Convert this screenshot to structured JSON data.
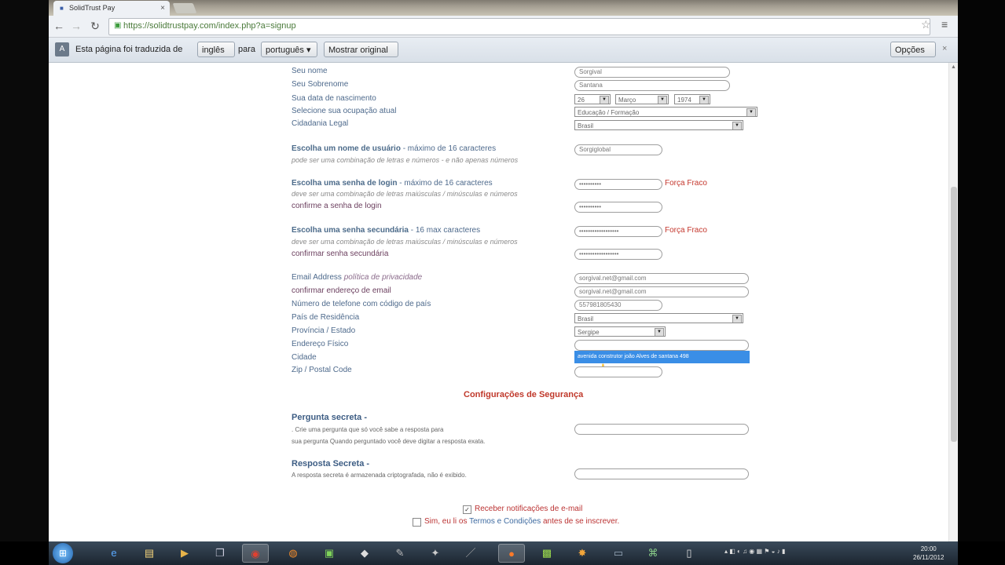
{
  "browser": {
    "tab_title": "SolidTrust Pay",
    "tab_close": "×",
    "url": "https://solidtrustpay.com/index.php?a=signup"
  },
  "translate_bar": {
    "text_before": "Esta página foi traduzida de",
    "from_lang": "inglês",
    "text_middle": "para",
    "to_lang": "português",
    "show_original": "Mostrar original",
    "options": "Opções",
    "close": "×"
  },
  "form": {
    "first_name": {
      "label": "Seu nome",
      "value": "Sorgival"
    },
    "last_name": {
      "label": "Seu Sobrenome",
      "value": "Santana"
    },
    "dob": {
      "label": "Sua data de nascimento",
      "day": "26",
      "month": "Março",
      "year": "1974"
    },
    "occupation": {
      "label": "Selecione sua ocupação atual",
      "value": "Educação / Formação"
    },
    "citizenship": {
      "label": "Cidadania Legal",
      "value": "Brasil"
    },
    "username": {
      "label_bold": "Escolha um nome de usuário",
      "label_rest": " - máximo de 16 caracteres",
      "hint": "pode ser uma combinação de letras e números - e não apenas números",
      "value": "Sorgiglobal"
    },
    "login_password": {
      "label_bold": "Escolha uma senha de login",
      "label_rest": " - máximo de 16 caracteres",
      "hint": "deve ser uma combinação de letras maiúsculas / minúsculas e números",
      "value": "••••••••••",
      "strength": "Força Fraco"
    },
    "confirm_login_password": {
      "label": "confirme a senha de login",
      "value": "••••••••••"
    },
    "secondary_password": {
      "label_bold": "Escolha uma senha secundária",
      "label_rest": " - 16 max caracteres",
      "hint": "deve ser uma combinação de letras maiúsculas / minúsculas e números",
      "value": "••••••••••••••••••",
      "strength": "Força Fraco"
    },
    "confirm_secondary_password": {
      "label": "confirmar senha secundária",
      "value": "••••••••••••••••••"
    },
    "email": {
      "label": "Email Address",
      "privacy": "política de privacidade",
      "value": "sorgival.net@gmail.com"
    },
    "confirm_email": {
      "label": "confirmar endereço de email",
      "value": "sorgival.net@gmail.com"
    },
    "phone": {
      "label": "Número de telefone com código de país",
      "value": "557981805430"
    },
    "country": {
      "label": "País de Residência",
      "value": "Brasil"
    },
    "province": {
      "label": "Província / Estado",
      "value": "Sergipe"
    },
    "address": {
      "label": "Endereço Físico",
      "value": "",
      "autocomplete": "avenida construtor joão Alves de santana 498"
    },
    "city": {
      "label": "Cidade",
      "value": ""
    },
    "zip": {
      "label": "Zip / Postal Code",
      "value": ""
    }
  },
  "security": {
    "title": "Configurações de Segurança",
    "question_title": "Pergunta secreta -",
    "question_line1": ". Crie uma pergunta que só você sabe a resposta para",
    "question_line2": "sua pergunta Quando perguntado você deve digitar a resposta exata.",
    "answer_title": "Resposta Secreta -",
    "answer_line1": "A resposta secreta é armazenada criptografada, não é exibido."
  },
  "checkboxes": {
    "email_notify": "Receber notificações de e-mail",
    "terms_prefix": "Sim, eu li os ",
    "terms_link": "Termos e Condições",
    "terms_suffix": " antes de se inscrever."
  },
  "taskbar": {
    "clock_time": "20:00",
    "clock_date": "26/11/2012"
  }
}
